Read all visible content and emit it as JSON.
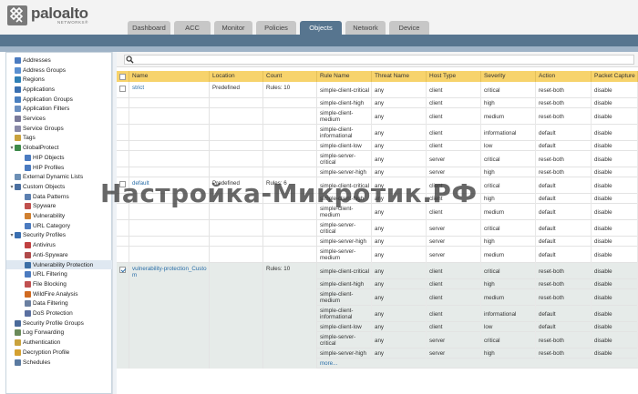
{
  "brand": {
    "name": "paloalto",
    "sub": "NETWORKS®"
  },
  "tabs": [
    {
      "label": "Dashboard",
      "active": false
    },
    {
      "label": "ACC",
      "active": false
    },
    {
      "label": "Monitor",
      "active": false
    },
    {
      "label": "Policies",
      "active": false
    },
    {
      "label": "Objects",
      "active": true
    },
    {
      "label": "Network",
      "active": false
    },
    {
      "label": "Device",
      "active": false
    }
  ],
  "sidebar": {
    "items": [
      {
        "label": "Addresses",
        "level": 0,
        "icon": "address-icon"
      },
      {
        "label": "Address Groups",
        "level": 0,
        "icon": "address-group-icon"
      },
      {
        "label": "Regions",
        "level": 0,
        "icon": "region-icon"
      },
      {
        "label": "Applications",
        "level": 0,
        "icon": "application-icon"
      },
      {
        "label": "Application Groups",
        "level": 0,
        "icon": "application-group-icon"
      },
      {
        "label": "Application Filters",
        "level": 0,
        "icon": "application-filter-icon"
      },
      {
        "label": "Services",
        "level": 0,
        "icon": "service-icon"
      },
      {
        "label": "Service Groups",
        "level": 0,
        "icon": "service-group-icon"
      },
      {
        "label": "Tags",
        "level": 0,
        "icon": "tag-icon"
      },
      {
        "label": "GlobalProtect",
        "level": 0,
        "icon": "globalprotect-icon",
        "expanded": true
      },
      {
        "label": "HIP Objects",
        "level": 1,
        "icon": "hip-object-icon"
      },
      {
        "label": "HIP Profiles",
        "level": 1,
        "icon": "hip-profile-icon"
      },
      {
        "label": "External Dynamic Lists",
        "level": 0,
        "icon": "external-list-icon"
      },
      {
        "label": "Custom Objects",
        "level": 0,
        "icon": "custom-objects-icon",
        "expanded": true
      },
      {
        "label": "Data Patterns",
        "level": 1,
        "icon": "data-pattern-icon"
      },
      {
        "label": "Spyware",
        "level": 1,
        "icon": "spyware-icon"
      },
      {
        "label": "Vulnerability",
        "level": 1,
        "icon": "vulnerability-icon"
      },
      {
        "label": "URL Category",
        "level": 1,
        "icon": "url-category-icon"
      },
      {
        "label": "Security Profiles",
        "level": 0,
        "icon": "security-profiles-icon",
        "expanded": true
      },
      {
        "label": "Antivirus",
        "level": 1,
        "icon": "antivirus-icon"
      },
      {
        "label": "Anti-Spyware",
        "level": 1,
        "icon": "anti-spyware-icon"
      },
      {
        "label": "Vulnerability Protection",
        "level": 1,
        "icon": "vulnerability-protection-icon",
        "selected": true
      },
      {
        "label": "URL Filtering",
        "level": 1,
        "icon": "url-filtering-icon"
      },
      {
        "label": "File Blocking",
        "level": 1,
        "icon": "file-blocking-icon"
      },
      {
        "label": "WildFire Analysis",
        "level": 1,
        "icon": "wildfire-icon"
      },
      {
        "label": "Data Filtering",
        "level": 1,
        "icon": "data-filtering-icon"
      },
      {
        "label": "DoS Protection",
        "level": 1,
        "icon": "dos-protection-icon"
      },
      {
        "label": "Security Profile Groups",
        "level": 0,
        "icon": "profile-group-icon"
      },
      {
        "label": "Log Forwarding",
        "level": 0,
        "icon": "log-forwarding-icon"
      },
      {
        "label": "Authentication",
        "level": 0,
        "icon": "authentication-icon"
      },
      {
        "label": "Decryption Profile",
        "level": 0,
        "icon": "decryption-icon"
      },
      {
        "label": "Schedules",
        "level": 0,
        "icon": "schedule-icon"
      }
    ]
  },
  "table": {
    "headers": [
      "Name",
      "Location",
      "Count",
      "Rule Name",
      "Threat Name",
      "Host Type",
      "Severity",
      "Action",
      "Packet Capture"
    ],
    "groups": [
      {
        "name": "strict",
        "location": "Predefined",
        "count": "Rules: 10",
        "checked": false,
        "selected": false,
        "rules": [
          [
            "simple-client-critical",
            "any",
            "client",
            "critical",
            "reset-both",
            "disable"
          ],
          [
            "simple-client-high",
            "any",
            "client",
            "high",
            "reset-both",
            "disable"
          ],
          [
            "simple-client-medium",
            "any",
            "client",
            "medium",
            "reset-both",
            "disable"
          ],
          [
            "simple-client-informational",
            "any",
            "client",
            "informational",
            "default",
            "disable"
          ],
          [
            "simple-client-low",
            "any",
            "client",
            "low",
            "default",
            "disable"
          ],
          [
            "simple-server-critical",
            "any",
            "server",
            "critical",
            "reset-both",
            "disable"
          ],
          [
            "simple-server-high",
            "any",
            "server",
            "high",
            "reset-both",
            "disable"
          ]
        ]
      },
      {
        "name": "default",
        "location": "Predefined",
        "count": "Rules: 6",
        "checked": false,
        "selected": false,
        "rules": [
          [
            "simple-client-critical",
            "any",
            "client",
            "critical",
            "default",
            "disable"
          ],
          [
            "simple-client-high",
            "any",
            "client",
            "high",
            "default",
            "disable"
          ],
          [
            "simple-client-medium",
            "any",
            "client",
            "medium",
            "default",
            "disable"
          ],
          [
            "simple-server-critical",
            "any",
            "server",
            "critical",
            "default",
            "disable"
          ],
          [
            "simple-server-high",
            "any",
            "server",
            "high",
            "default",
            "disable"
          ],
          [
            "simple-server-medium",
            "any",
            "server",
            "medium",
            "default",
            "disable"
          ]
        ]
      },
      {
        "name": "vulnerability-protection_Custom",
        "location": "",
        "count": "Rules: 10",
        "checked": true,
        "selected": true,
        "rules": [
          [
            "simple-client-critical",
            "any",
            "client",
            "critical",
            "reset-both",
            "disable"
          ],
          [
            "simple-client-high",
            "any",
            "client",
            "high",
            "reset-both",
            "disable"
          ],
          [
            "simple-client-medium",
            "any",
            "client",
            "medium",
            "reset-both",
            "disable"
          ],
          [
            "simple-client-informational",
            "any",
            "client",
            "informational",
            "default",
            "disable"
          ],
          [
            "simple-client-low",
            "any",
            "client",
            "low",
            "default",
            "disable"
          ],
          [
            "simple-server-critical",
            "any",
            "server",
            "critical",
            "reset-both",
            "disable"
          ],
          [
            "simple-server-high",
            "any",
            "server",
            "high",
            "reset-both",
            "disable"
          ]
        ],
        "more": "more..."
      }
    ]
  },
  "watermark": "Настройка-Микротик.РФ",
  "colors": {
    "header_bar": "#57758f",
    "table_header": "#f7d36c",
    "link": "#2a6ea8",
    "selected_row": "#e6ebe9"
  }
}
